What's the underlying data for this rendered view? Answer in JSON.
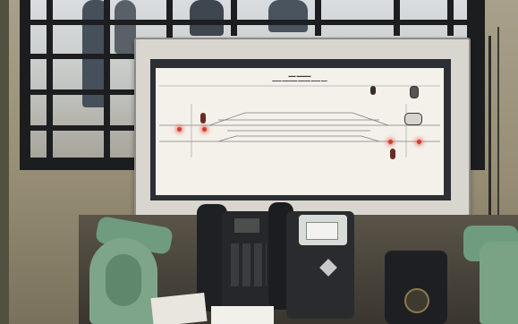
{
  "image": {
    "alt": "Railway station signal cabin with track diagram panel board and telephones",
    "colors": {
      "board_face": "#f3f1ea",
      "board_frame": "#2c2f33",
      "indicator_red": "#d43b2f",
      "phone_green": "#6f9c7f",
      "phone_black": "#1e1f22",
      "window_bars": "#1d1e20"
    },
    "icons": [
      "window-bars-icon",
      "signal-lamp-icon",
      "telephone-icon"
    ]
  }
}
